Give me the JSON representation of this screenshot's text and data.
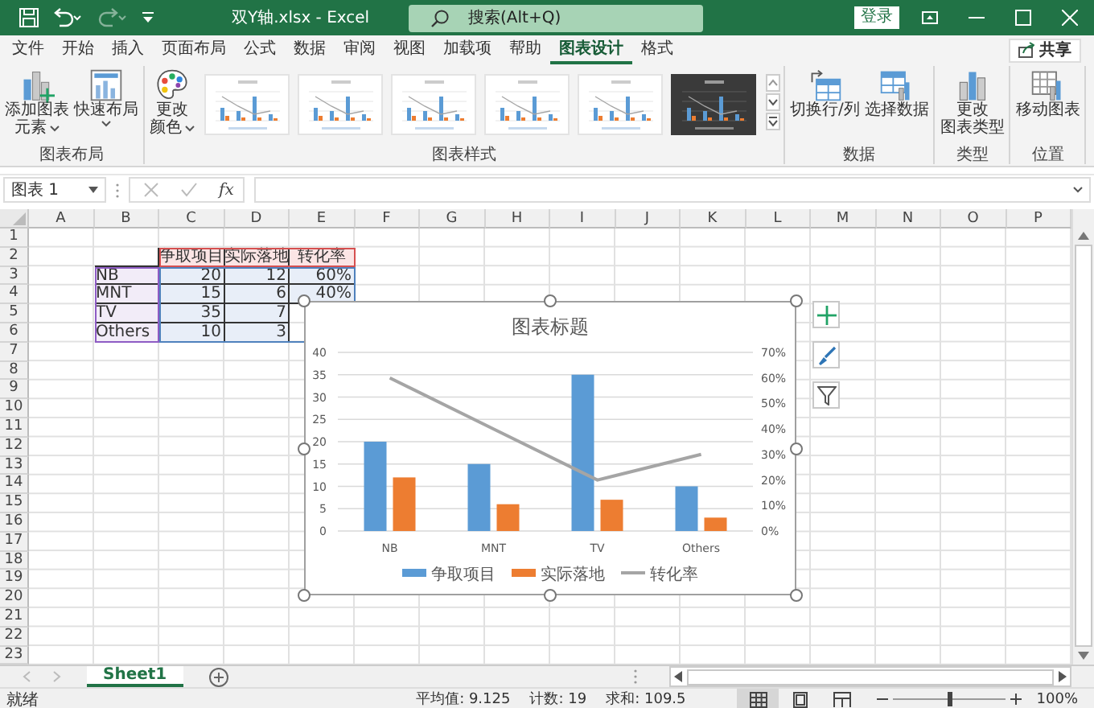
{
  "window": {
    "title": "双Y轴.xlsx  -  Excel",
    "search": {
      "placeholder": "搜索(Alt+Q)"
    },
    "sign_in": "登录",
    "quick_access": [
      {
        "kind": "save",
        "disabled": false
      },
      {
        "kind": "undo",
        "disabled": false
      },
      {
        "kind": "redo",
        "disabled": true
      },
      {
        "kind": "customize",
        "disabled": false
      }
    ]
  },
  "menu_tabs": [
    {
      "label": "文件",
      "selected": false
    },
    {
      "label": "开始",
      "selected": false
    },
    {
      "label": "插入",
      "selected": false
    },
    {
      "label": "页面布局",
      "selected": false
    },
    {
      "label": "公式",
      "selected": false
    },
    {
      "label": "数据",
      "selected": false
    },
    {
      "label": "审阅",
      "selected": false
    },
    {
      "label": "视图",
      "selected": false
    },
    {
      "label": "加载项",
      "selected": false
    },
    {
      "label": "帮助",
      "selected": false
    },
    {
      "label": "图表设计",
      "selected": true
    },
    {
      "label": "格式",
      "selected": false
    }
  ],
  "share_button": "共享",
  "ribbon": {
    "groups": [
      {
        "label": "图表布局",
        "buttons": [
          {
            "kind": "add-element",
            "label": [
              "添加图表",
              "元素"
            ],
            "dropdown": true
          },
          {
            "kind": "layout",
            "label": [
              "快速布局"
            ],
            "dropdown": true
          }
        ]
      },
      {
        "label": "图表样式",
        "buttons": [
          {
            "kind": "colors",
            "label": [
              "更改",
              "颜色"
            ],
            "dropdown": true
          }
        ],
        "styles": [
          {
            "kind": "light"
          },
          {
            "kind": "light"
          },
          {
            "kind": "light"
          },
          {
            "kind": "light"
          },
          {
            "kind": "light"
          },
          {
            "kind": "dark"
          }
        ]
      },
      {
        "label": "数据",
        "buttons": [
          {
            "kind": "switch",
            "label": [
              "切换行/列"
            ],
            "dropdown": false
          },
          {
            "kind": "select-data",
            "label": [
              "选择数据"
            ],
            "dropdown": false
          }
        ]
      },
      {
        "label": "类型",
        "buttons": [
          {
            "kind": "change-type",
            "label": [
              "更改",
              "图表类型"
            ],
            "dropdown": false
          }
        ]
      },
      {
        "label": "位置",
        "buttons": [
          {
            "kind": "move",
            "label": [
              "移动图表"
            ],
            "dropdown": false
          }
        ]
      }
    ]
  },
  "formula_bar": {
    "name_box": "图表 1",
    "function_label": "fx"
  },
  "sheet": {
    "columns": [
      "A",
      "B",
      "C",
      "D",
      "E",
      "F",
      "G",
      "H",
      "I",
      "J",
      "K",
      "L",
      "M",
      "N",
      "O",
      "P"
    ],
    "rows": [
      "1",
      "2",
      "3",
      "4",
      "5",
      "6",
      "7",
      "8",
      "9",
      "10",
      "11",
      "12",
      "13",
      "14",
      "15",
      "16",
      "17",
      "18",
      "19",
      "20",
      "21",
      "22",
      "23"
    ],
    "data_block": {
      "source_highlighted": true,
      "header": [
        "争取项目",
        "实际落地",
        "转化率"
      ],
      "rows": [
        {
          "label": "NB",
          "values": [
            "20",
            "12",
            "60%"
          ]
        },
        {
          "label": "MNT",
          "values": [
            "15",
            "6",
            "40%"
          ]
        },
        {
          "label": "TV",
          "values": [
            "35",
            "7"
          ]
        },
        {
          "label": "Others",
          "values": [
            "10",
            "3"
          ]
        }
      ]
    }
  },
  "chart": {
    "selected": true,
    "chart_data": {
      "type": "bar",
      "title": "图表标题",
      "categories": [
        "NB",
        "MNT",
        "TV",
        "Others"
      ],
      "series": [
        {
          "name": "争取项目",
          "type": "bar",
          "color": "#5b9bd5",
          "values": [
            20,
            15,
            35,
            10
          ]
        },
        {
          "name": "实际落地",
          "type": "bar",
          "color": "#ed7d31",
          "values": [
            12,
            6,
            7,
            3
          ]
        },
        {
          "name": "转化率",
          "type": "line",
          "axis": "y2",
          "color": "#a5a5a5",
          "values": [
            0.6,
            0.4,
            0.2,
            0.3
          ]
        }
      ],
      "grid": true,
      "legend": "bottom",
      "ylim": [
        0,
        40
      ],
      "yticks": [
        0,
        5,
        10,
        15,
        20,
        25,
        30,
        35,
        40
      ],
      "y2lim": [
        0,
        0.7
      ],
      "y2ticks": [
        {
          "value": 0,
          "label": "0%"
        },
        {
          "value": 0.1,
          "label": "10%"
        },
        {
          "value": 0.2,
          "label": "20%"
        },
        {
          "value": 0.3,
          "label": "30%"
        },
        {
          "value": 0.4,
          "label": "40%"
        },
        {
          "value": 0.5,
          "label": "50%"
        },
        {
          "value": 0.6,
          "label": "60%"
        },
        {
          "value": 0.7,
          "label": "70%"
        }
      ]
    }
  },
  "sheet_tabs": [
    {
      "label": "Sheet1",
      "selected": true
    }
  ],
  "status_bar": {
    "mode": "就绪",
    "stats": [
      "平均值: 9.125",
      "计数: 19",
      "求和: 109.5"
    ],
    "views": [
      {
        "kind": "normal",
        "selected": true
      },
      {
        "kind": "page-layout",
        "selected": false
      },
      {
        "kind": "page-break",
        "selected": false
      }
    ],
    "zoom": {
      "level": 0.5,
      "reading": "100%"
    }
  }
}
